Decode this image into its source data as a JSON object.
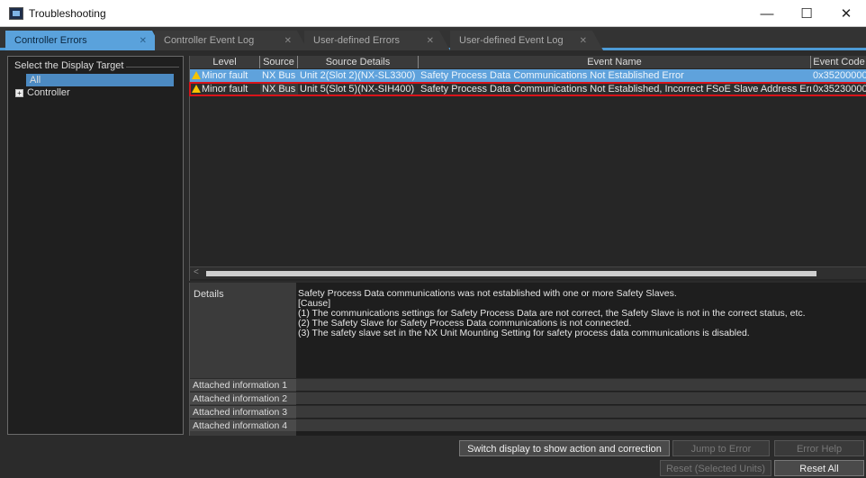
{
  "window": {
    "title": "Troubleshooting",
    "minimize": "—",
    "maximize": "☐",
    "close": "✕"
  },
  "tabs": [
    {
      "label": "Controller Errors",
      "active": true
    },
    {
      "label": "Controller Event Log",
      "active": false
    },
    {
      "label": "User-defined Errors",
      "active": false
    },
    {
      "label": "User-defined Event Log",
      "active": false
    }
  ],
  "tab_close": "✕",
  "left_panel": {
    "legend": "Select the Display Target",
    "items": [
      {
        "label": "All",
        "selected": true
      },
      {
        "label": "Controller",
        "expander": "+"
      }
    ]
  },
  "table": {
    "columns": [
      "Level",
      "Source",
      "Source Details",
      "Event Name",
      "Event Code"
    ],
    "rows": [
      {
        "level": "Minor fault",
        "source": "NX Bus",
        "source_details": "Unit 2(Slot 2)(NX-SL3300)",
        "event_name": "Safety Process Data Communications Not Established Error",
        "event_code": "0x35200000",
        "selected": true
      },
      {
        "level": "Minor fault",
        "source": "NX Bus",
        "source_details": "Unit 5(Slot 5)(NX-SIH400)",
        "event_name": "Safety Process Data Communications Not Established, Incorrect FSoE Slave Address Error",
        "event_code": "0x35230000",
        "highlighted": true
      }
    ],
    "scroll_left": "<"
  },
  "details": {
    "label": "Details",
    "lines": [
      "Safety Process Data communications was not established with one or more Safety Slaves.",
      "[Cause]",
      "(1) The communications settings for Safety Process Data are not correct, the Safety Slave is not in the correct status, etc.",
      "(2) The Safety Slave for Safety Process Data communications is not connected.",
      "(3) The safety slave set in the NX Unit Mounting Setting for safety process data communications is disabled."
    ],
    "attached": [
      "Attached information 1",
      "Attached information 2",
      "Attached information 3",
      "Attached information 4"
    ]
  },
  "buttons": {
    "switch_display": "Switch display to show action and correction",
    "jump_to_error": "Jump to Error",
    "error_help": "Error Help",
    "reset_selected": "Reset (Selected Units)",
    "reset_all": "Reset All"
  },
  "colors": {
    "accent": "#5aa2dc",
    "highlight_border": "#d8141a",
    "warning": "#f5c400"
  }
}
